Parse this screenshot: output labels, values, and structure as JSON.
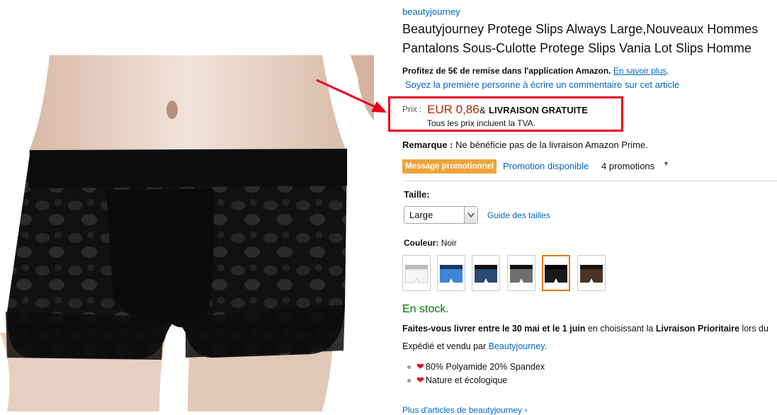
{
  "product": {
    "brand": "beautyjourney",
    "title_line1": "Beautyjourney Protege Slips Always Large,Nouveaux Hommes",
    "title_line2": "Pantalons Sous-Culotte Protege Slips Vania Lot Slips Homme",
    "promo_app_text": "Profitez de 5€ de remise dans l'application Amazon.",
    "promo_app_link": "En savoir plus",
    "review_link": "Soyez la première personne à écrire un commentaire sur cet article"
  },
  "price": {
    "label": "Prix :",
    "value": "EUR 0,86",
    "amp": "&",
    "free_shipping": "LIVRAISON GRATUITE",
    "vat_note": "Tous les prix incluent la TVA."
  },
  "remark": {
    "label": "Remarque :",
    "text": "Ne bénéficie pas de la livraison Amazon Prime."
  },
  "promotion": {
    "badge": "Message promotionnel",
    "link": "Promotion disponible",
    "count": "4 promotions",
    "badge_color": "#f0a33a"
  },
  "size": {
    "label": "Taille:",
    "selected": "Large",
    "guide_link": "Guide des tailles"
  },
  "color": {
    "label": "Couleur:",
    "selected": "Noir",
    "swatches": [
      "white",
      "blue",
      "navy",
      "grey",
      "black",
      "brown"
    ],
    "selected_index": 4
  },
  "availability": {
    "stock": "En stock.",
    "stock_color": "#007600",
    "delivery_bold1": "Faites-vous livrer entre le 30 mai et le 1 juin",
    "delivery_mid": "en choisissant la",
    "delivery_bold2": "Livraison Prioritaire",
    "delivery_tail": "lors du",
    "shipped_prefix": "Expédié et vendu par",
    "seller": "Beautyjourney",
    "shipped_suffix": "."
  },
  "bullets": [
    "80% Polyamide 20% Spandex",
    "Nature et écologique"
  ],
  "more_link": "Plus d'articles de beautyjourney",
  "colors": {
    "link": "#0066c0",
    "price": "#b12704",
    "annotation": "#e8001f"
  }
}
